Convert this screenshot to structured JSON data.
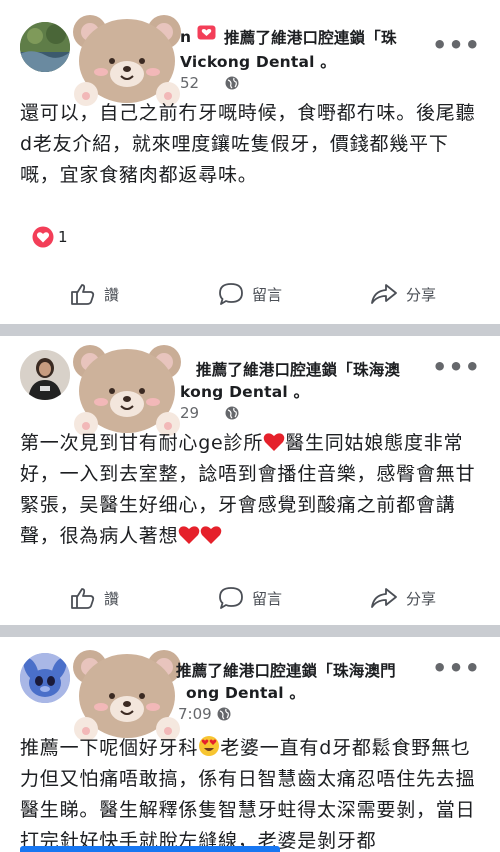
{
  "posts": [
    {
      "name_visible": "n",
      "recommends_line1": "推薦了維港口腔連鎖「珠",
      "recommends_line2": "Vickong Dental 。",
      "time": "52",
      "body": "還可以，自己之前冇牙嘅時候，食嘢都冇味。後尾聽d老友介紹，就來哩度鑲咗隻假牙，價錢都幾平下嘅，宜家食豬肉都返尋味。",
      "reaction_count": "1",
      "reaction_icon": "heart-reaction-icon"
    },
    {
      "recommends_line1": "推薦了維港口腔連鎖「珠海澳",
      "recommends_line2": "kong Dental 。",
      "time": "29",
      "body_parts": [
        "第一次見到甘有耐心ge診所",
        "醫生同姑娘態度非常好，一入到去室整，諗唔到會播住音樂，感臀會無甘緊張，吴醫生好细心，牙會感覺到酸痛之前都會講聲，很為病人著想"
      ]
    },
    {
      "recommends_line1": "推薦了維港口腔連鎖「珠海澳門",
      "recommends_line2": "ong Dental 。",
      "time": "7:09",
      "body_parts": [
        "推薦一下呢個好牙科",
        "老婆一直有d牙都鬆食野無乜力但又怕痛唔敢搞，係有日智慧齒太痛忍唔住先去搵醫生睇。醫生解釋係隻智慧牙蛀得太深需要剝，當日打完針好快手就脫左縫線，老婆是剝牙都"
      ]
    }
  ],
  "actions": {
    "like_label": "讚",
    "comment_label": "留言",
    "share_label": "分享"
  },
  "colors": {
    "accent": "#1877f2",
    "reaction_red": "#f33e58",
    "separator": "#c9ccd1"
  }
}
